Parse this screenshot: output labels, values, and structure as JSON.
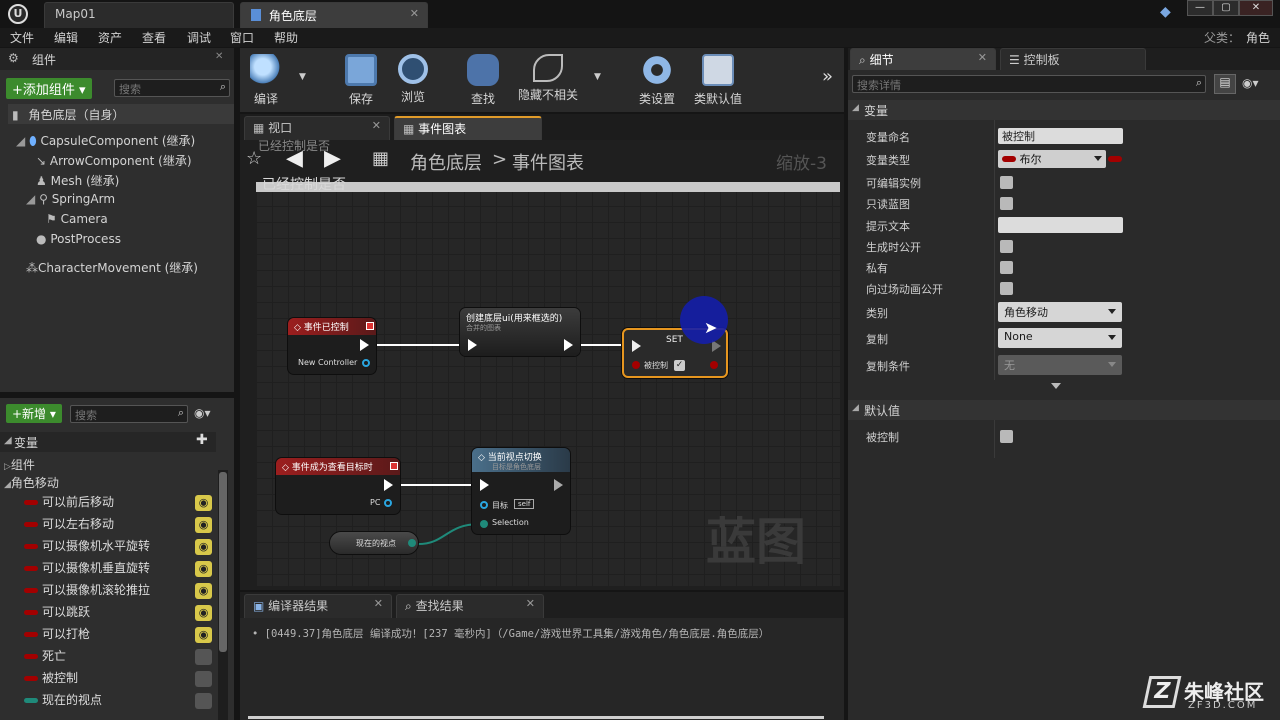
{
  "titlebar": {
    "tabs": [
      {
        "label": "Map01"
      },
      {
        "label": "角色底层"
      }
    ],
    "parent_label": "父类：",
    "parent_value": "角色"
  },
  "menu": [
    "文件",
    "编辑",
    "资产",
    "查看",
    "调试",
    "窗口",
    "帮助"
  ],
  "components": {
    "tab_label": "组件",
    "add_button": "+添加组件",
    "search_placeholder": "搜索",
    "root": "角色底层（自身）",
    "items": [
      "CapsuleComponent (继承)",
      "ArrowComponent (继承)",
      "Mesh (继承)",
      "SpringArm",
      "Camera",
      "PostProcess",
      "CharacterMovement (继承)"
    ]
  },
  "toolbar": {
    "buttons": [
      "编译",
      "保存",
      "浏览",
      "查找",
      "隐藏不相关",
      "类设置",
      "类默认值"
    ]
  },
  "editor_tabs": [
    {
      "label": "视口"
    },
    {
      "label": "事件图表"
    }
  ],
  "graph": {
    "breadcrumb_root": "角色底层",
    "breadcrumb_sep": ">",
    "breadcrumb_leaf": "事件图表",
    "zoom": "缩放-3",
    "tooltip_ghost": "已经控制是否",
    "comment": "已经控制是否",
    "watermark": "蓝图",
    "nodes": {
      "event_possessed": {
        "title": "事件已控制",
        "pin": "New Controller"
      },
      "create_ui": {
        "title": "创建底层ui(用来框选的)",
        "subtitle": "合并的图表"
      },
      "set": {
        "title": "SET",
        "pin": "被控制"
      },
      "event_view_target": {
        "title": "事件成为查看目标时",
        "pin": "PC"
      },
      "set_view_target": {
        "title": "当前视点切换",
        "subtitle": "目标是角色底层",
        "target_label": "目标",
        "target_value": "self",
        "selection": "Selection"
      },
      "current_view": {
        "title": "现在的视点"
      }
    }
  },
  "my_blueprint": {
    "new_button": "+新增",
    "search_placeholder": "搜索",
    "variables_header": "变量",
    "category_components": "组件",
    "category_movement": "角色移动",
    "variables": [
      {
        "name": "可以前后移动",
        "color": "#a30000",
        "eye": "open"
      },
      {
        "name": "可以左右移动",
        "color": "#a30000",
        "eye": "open"
      },
      {
        "name": "可以摄像机水平旋转",
        "color": "#a30000",
        "eye": "open"
      },
      {
        "name": "可以摄像机垂直旋转",
        "color": "#a30000",
        "eye": "open"
      },
      {
        "name": "可以摄像机滚轮推拉",
        "color": "#a30000",
        "eye": "open"
      },
      {
        "name": "可以跳跃",
        "color": "#a30000",
        "eye": "open"
      },
      {
        "name": "可以打枪",
        "color": "#a30000",
        "eye": "open"
      },
      {
        "name": "死亡",
        "color": "#a30000",
        "eye": "closed"
      },
      {
        "name": "被控制",
        "color": "#a30000",
        "eye": "closed"
      },
      {
        "name": "现在的视点",
        "color": "#1f8a7a",
        "eye": "closed"
      }
    ]
  },
  "bottom": {
    "tabs": [
      {
        "label": "编译器结果"
      },
      {
        "label": "查找结果"
      }
    ],
    "log": "[0449.37]角色底层 编译成功！[237 毫秒内]（/Game/游戏世界工具集/游戏角色/角色底层.角色底层）"
  },
  "details": {
    "tabs": [
      {
        "label": "细节"
      },
      {
        "label": "控制板"
      }
    ],
    "search_placeholder": "搜索详情",
    "section_variable": "变量",
    "section_default": "默认值",
    "props": {
      "name_label": "变量命名",
      "name_value": "被控制",
      "type_label": "变量类型",
      "type_value": "布尔",
      "editable_label": "可编辑实例",
      "readonly_label": "只读蓝图",
      "tooltip_label": "提示文本",
      "expose_label": "生成时公开",
      "private_label": "私有",
      "cinematic_label": "向过场动画公开",
      "category_label": "类别",
      "category_value": "角色移动",
      "replication_label": "复制",
      "replication_value": "None",
      "repcond_label": "复制条件",
      "repcond_value": "无",
      "default_label": "被控制"
    }
  },
  "brand": {
    "name": "朱峰社区",
    "url": "ZF3D.COM"
  }
}
